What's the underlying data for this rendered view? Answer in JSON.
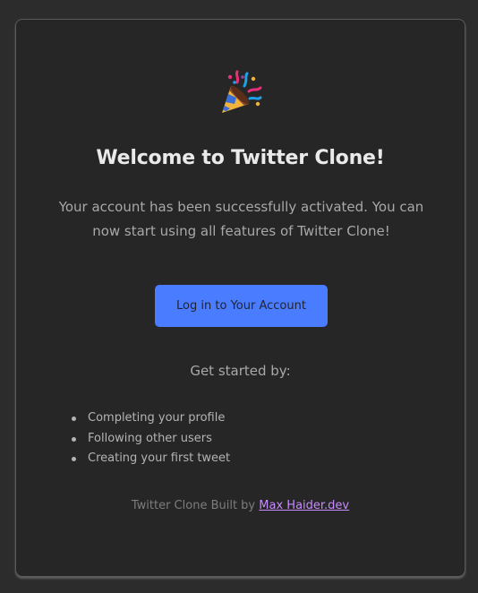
{
  "email": {
    "emoji": "party-popper-icon",
    "title": "Welcome to Twitter Clone!",
    "message": "Your account has been successfully activated. You can now start using all features of Twitter Clone!",
    "button_label": "Log in to Your Account",
    "get_started_label": "Get started by:",
    "steps": [
      "Completing your profile",
      "Following other users",
      "Creating your first tweet"
    ],
    "footer_prefix": "Twitter Clone Built by",
    "footer_link": "Max Haider.dev"
  },
  "colors": {
    "background": "#2c2c2c",
    "card": "#262626",
    "button": "#4a7cff",
    "link": "#c78cff"
  }
}
